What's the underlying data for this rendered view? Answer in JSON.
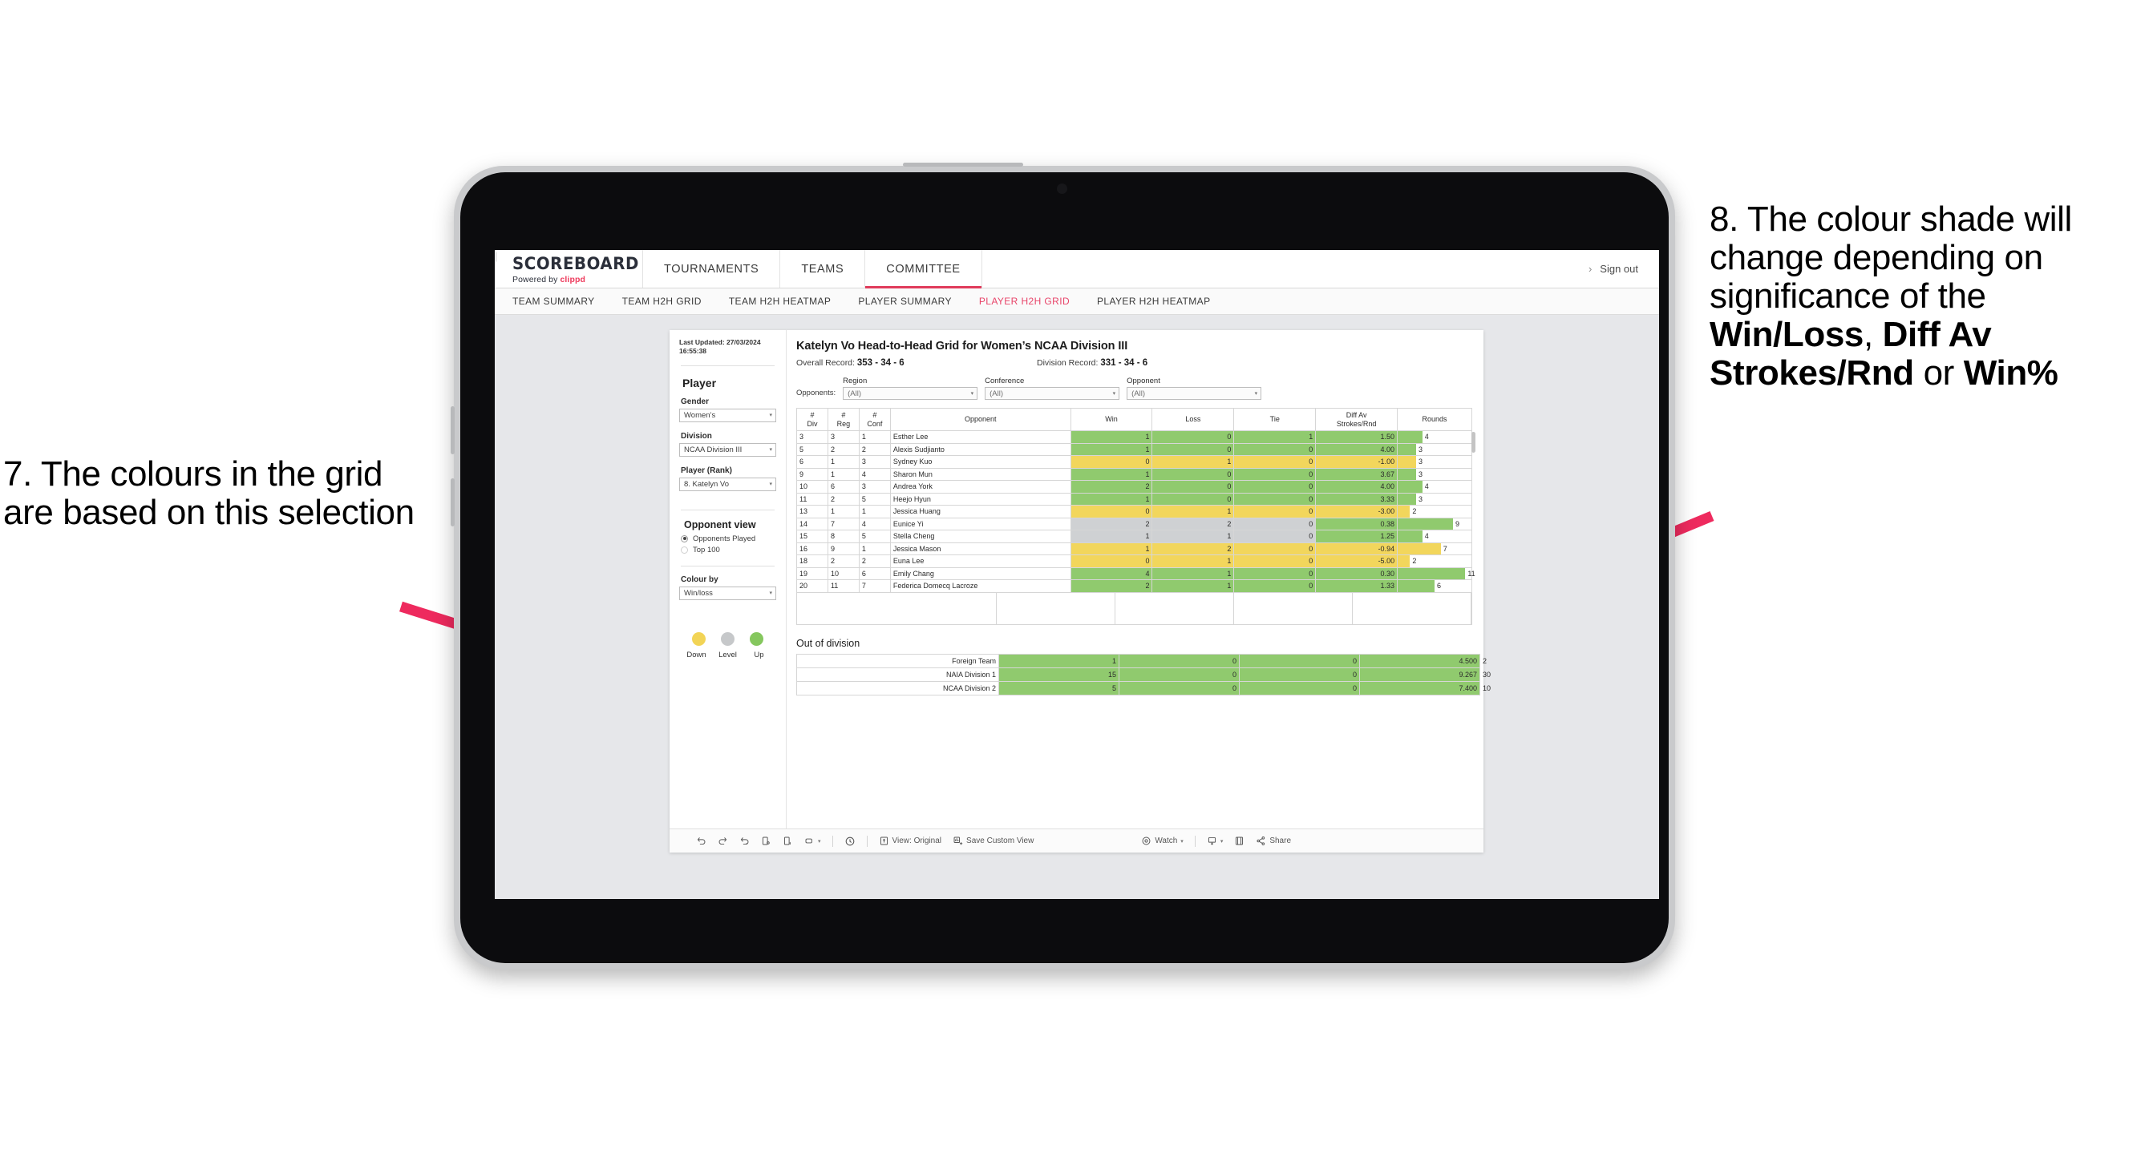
{
  "annotations": {
    "left": "7. The colours in the grid are based on this selection",
    "right_prefix": "8. The colour shade will change depending on significance of the ",
    "right_b1": "Win/Loss",
    "right_mid1": ", ",
    "right_b2": "Diff Av Strokes/Rnd",
    "right_mid2": " or ",
    "right_b3": "Win%",
    "arrow_color": "#ee2a5e"
  },
  "topnav": {
    "brand_title": "SCOREBOARD",
    "brand_sub_prefix": "Powered by ",
    "brand_sub_brand": "clippd",
    "items": [
      {
        "label": "TOURNAMENTS",
        "active": false
      },
      {
        "label": "TEAMS",
        "active": false
      },
      {
        "label": "COMMITTEE",
        "active": true
      }
    ],
    "chevron": "›",
    "divider": "|",
    "signout": "Sign out"
  },
  "subnav": {
    "items": [
      {
        "label": "TEAM SUMMARY",
        "active": false
      },
      {
        "label": "TEAM H2H GRID",
        "active": false
      },
      {
        "label": "TEAM H2H HEATMAP",
        "active": false
      },
      {
        "label": "PLAYER SUMMARY",
        "active": false
      },
      {
        "label": "PLAYER H2H GRID",
        "active": true
      },
      {
        "label": "PLAYER H2H HEATMAP",
        "active": false
      }
    ]
  },
  "sidebar": {
    "last_updated": "Last Updated: 27/03/2024 16:55:38",
    "player_heading": "Player",
    "gender_label": "Gender",
    "gender_value": "Women’s",
    "division_label": "Division",
    "division_value": "NCAA Division III",
    "player_rank_label": "Player (Rank)",
    "player_rank_value": "8. Katelyn Vo",
    "opponent_view_heading": "Opponent view",
    "opponent_view_options": [
      {
        "label": "Opponents Played",
        "selected": true
      },
      {
        "label": "Top 100",
        "selected": false
      }
    ],
    "colour_by_label": "Colour by",
    "colour_by_value": "Win/loss",
    "legend": [
      {
        "label": "Down",
        "color": "#f2d456"
      },
      {
        "label": "Level",
        "color": "#c6c8ca"
      },
      {
        "label": "Up",
        "color": "#85c75e"
      }
    ],
    "caret": "▾"
  },
  "main": {
    "title": "Katelyn Vo Head-to-Head Grid for Women’s NCAA Division III",
    "overall_record_label": "Overall Record: ",
    "overall_record_value": "353 - 34 - 6",
    "division_record_label": "Division Record: ",
    "division_record_value": "331 - 34 - 6",
    "opponents_label": "Opponents:",
    "filters": [
      {
        "label": "Region",
        "value": "(All)"
      },
      {
        "label": "Conference",
        "value": "(All)"
      },
      {
        "label": "Opponent",
        "value": "(All)"
      }
    ],
    "ood_title": "Out of division"
  },
  "chart_data": {
    "type": "table",
    "title": "Katelyn Vo Head-to-Head Grid for Women’s NCAA Division III",
    "columns": [
      "# Div",
      "# Reg",
      "# Conf",
      "Opponent",
      "Win",
      "Loss",
      "Tie",
      "Diff Av Strokes/Rnd",
      "Rounds"
    ],
    "column_headers_multiline": [
      [
        "#",
        "Div"
      ],
      [
        "#",
        "Reg"
      ],
      [
        "#",
        "Conf"
      ],
      [
        "Opponent"
      ],
      [
        "Win"
      ],
      [
        "Loss"
      ],
      [
        "Tie"
      ],
      [
        "Diff Av",
        "Strokes/Rnd"
      ],
      [
        "Rounds"
      ]
    ],
    "rounds_max": 12,
    "colors": {
      "up": "#90ca6e",
      "down": "#f2d65c",
      "level": "#cfd1d3"
    },
    "rows": [
      {
        "div": "3",
        "reg": "3",
        "conf": "1",
        "opponent": "Esther Lee",
        "win": "1",
        "loss": "0",
        "tie": "1",
        "diff": "1.50",
        "rounds": "4",
        "shade": "up"
      },
      {
        "div": "5",
        "reg": "2",
        "conf": "2",
        "opponent": "Alexis Sudjianto",
        "win": "1",
        "loss": "0",
        "tie": "0",
        "diff": "4.00",
        "rounds": "3",
        "shade": "up"
      },
      {
        "div": "6",
        "reg": "1",
        "conf": "3",
        "opponent": "Sydney Kuo",
        "win": "0",
        "loss": "1",
        "tie": "0",
        "diff": "-1.00",
        "rounds": "3",
        "shade": "down"
      },
      {
        "div": "9",
        "reg": "1",
        "conf": "4",
        "opponent": "Sharon Mun",
        "win": "1",
        "loss": "0",
        "tie": "0",
        "diff": "3.67",
        "rounds": "3",
        "shade": "up"
      },
      {
        "div": "10",
        "reg": "6",
        "conf": "3",
        "opponent": "Andrea York",
        "win": "2",
        "loss": "0",
        "tie": "0",
        "diff": "4.00",
        "rounds": "4",
        "shade": "up"
      },
      {
        "div": "11",
        "reg": "2",
        "conf": "5",
        "opponent": "Heejo Hyun",
        "win": "1",
        "loss": "0",
        "tie": "0",
        "diff": "3.33",
        "rounds": "3",
        "shade": "up"
      },
      {
        "div": "13",
        "reg": "1",
        "conf": "1",
        "opponent": "Jessica Huang",
        "win": "0",
        "loss": "1",
        "tie": "0",
        "diff": "-3.00",
        "rounds": "2",
        "shade": "down"
      },
      {
        "div": "14",
        "reg": "7",
        "conf": "4",
        "opponent": "Eunice Yi",
        "win": "2",
        "loss": "2",
        "tie": "0",
        "diff": "0.38",
        "rounds": "9",
        "shade": "level",
        "diff_shade": "up"
      },
      {
        "div": "15",
        "reg": "8",
        "conf": "5",
        "opponent": "Stella Cheng",
        "win": "1",
        "loss": "1",
        "tie": "0",
        "diff": "1.25",
        "rounds": "4",
        "shade": "level",
        "diff_shade": "up"
      },
      {
        "div": "16",
        "reg": "9",
        "conf": "1",
        "opponent": "Jessica Mason",
        "win": "1",
        "loss": "2",
        "tie": "0",
        "diff": "-0.94",
        "rounds": "7",
        "shade": "down"
      },
      {
        "div": "18",
        "reg": "2",
        "conf": "2",
        "opponent": "Euna Lee",
        "win": "0",
        "loss": "1",
        "tie": "0",
        "diff": "-5.00",
        "rounds": "2",
        "shade": "down"
      },
      {
        "div": "19",
        "reg": "10",
        "conf": "6",
        "opponent": "Emily Chang",
        "win": "4",
        "loss": "1",
        "tie": "0",
        "diff": "0.30",
        "rounds": "11",
        "shade": "up"
      },
      {
        "div": "20",
        "reg": "11",
        "conf": "7",
        "opponent": "Federica Domecq Lacroze",
        "win": "2",
        "loss": "1",
        "tie": "0",
        "diff": "1.33",
        "rounds": "6",
        "shade": "up"
      }
    ],
    "out_of_division": {
      "rounds_max": 32,
      "rows": [
        {
          "name": "Foreign Team",
          "win": "1",
          "loss": "0",
          "tie": "0",
          "diff": "4.500",
          "rounds": "2",
          "shade": "up"
        },
        {
          "name": "NAIA Division 1",
          "win": "15",
          "loss": "0",
          "tie": "0",
          "diff": "9.267",
          "rounds": "30",
          "shade": "up"
        },
        {
          "name": "NCAA Division 2",
          "win": "5",
          "loss": "0",
          "tie": "0",
          "diff": "7.400",
          "rounds": "10",
          "shade": "up"
        }
      ]
    }
  },
  "toolbar": {
    "view_label": "View: Original",
    "save_label": "Save Custom View",
    "watch_label": "Watch",
    "share_label": "Share",
    "caret": "▾"
  }
}
